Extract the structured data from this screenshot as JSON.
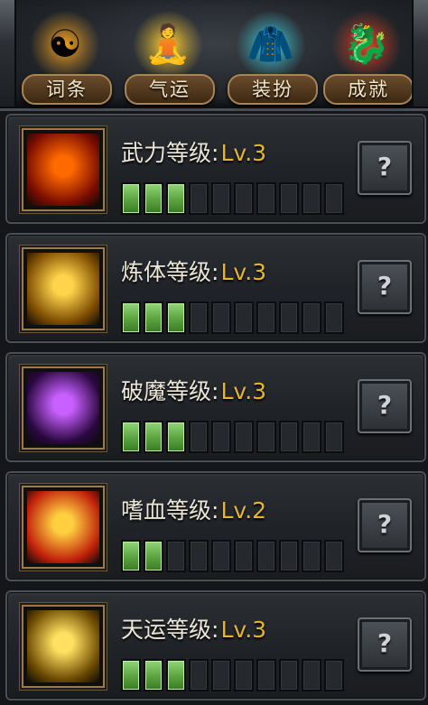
{
  "tabs": [
    {
      "label": "词条",
      "icon": "yin-yang-icon",
      "emoji": "☯",
      "glow": "#f0a020"
    },
    {
      "label": "气运",
      "icon": "meditating-figure-icon",
      "emoji": "🧘",
      "glow": "#ffcf30"
    },
    {
      "label": "装扮",
      "icon": "costume-icon",
      "emoji": "🧥",
      "glow": "#40d0e0"
    },
    {
      "label": "成就",
      "icon": "qilin-statue-icon",
      "emoji": "🐉",
      "glow": "#e04020"
    }
  ],
  "skills": [
    {
      "name": "武力等级",
      "colon": ":",
      "level": "Lv.3",
      "level_value": 3,
      "max_level": 10,
      "icon": "fire-dragon-icon",
      "colors": [
        "#ff6a00",
        "#7a0c00"
      ],
      "help_label": "?"
    },
    {
      "name": "炼体等级",
      "colon": ":",
      "level": "Lv.3",
      "level_value": 3,
      "max_level": 10,
      "icon": "body-tempering-icon",
      "colors": [
        "#ffd34a",
        "#7a4a00"
      ],
      "help_label": "?"
    },
    {
      "name": "破魔等级",
      "colon": ":",
      "level": "Lv.3",
      "level_value": 3,
      "max_level": 10,
      "icon": "demon-breaker-icon",
      "colors": [
        "#c860ff",
        "#2a0840"
      ],
      "help_label": "?"
    },
    {
      "name": "嗜血等级",
      "colon": ":",
      "level": "Lv.2",
      "level_value": 2,
      "max_level": 10,
      "icon": "bloodlust-icon",
      "colors": [
        "#ffcf40",
        "#c0200a"
      ],
      "help_label": "?"
    },
    {
      "name": "天运等级",
      "colon": ":",
      "level": "Lv.3",
      "level_value": 3,
      "max_level": 10,
      "icon": "fortune-vortex-icon",
      "colors": [
        "#ffe060",
        "#6a4800"
      ],
      "help_label": "?"
    }
  ]
}
